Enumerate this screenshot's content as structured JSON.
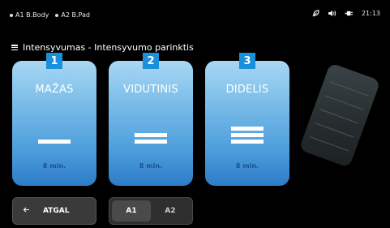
{
  "status": {
    "items": [
      {
        "label": "A1 B.Body"
      },
      {
        "label": "A2 B.Pad"
      }
    ],
    "time": "21:13",
    "icons": [
      "leaf-icon",
      "volume-icon",
      "power-plug-icon"
    ]
  },
  "header": {
    "title": "Intensyvumas - Intensyvumo parinktis"
  },
  "cards": [
    {
      "number": "1",
      "label": "MAŽAS",
      "duration": "8 min.",
      "level": 1
    },
    {
      "number": "2",
      "label": "VIDUTINIS",
      "duration": "8 min.",
      "level": 2
    },
    {
      "number": "3",
      "label": "DIDELIS",
      "duration": "8 min.",
      "level": 3
    }
  ],
  "footer": {
    "back_label": "ATGAL",
    "toggle": {
      "options": [
        "A1",
        "A2"
      ],
      "selected": "A1"
    }
  },
  "colors": {
    "card_top": "#a8d7f3",
    "card_bottom": "#2d7cc7",
    "badge": "#1a8fdc",
    "duration_text": "#1d4f9a"
  }
}
